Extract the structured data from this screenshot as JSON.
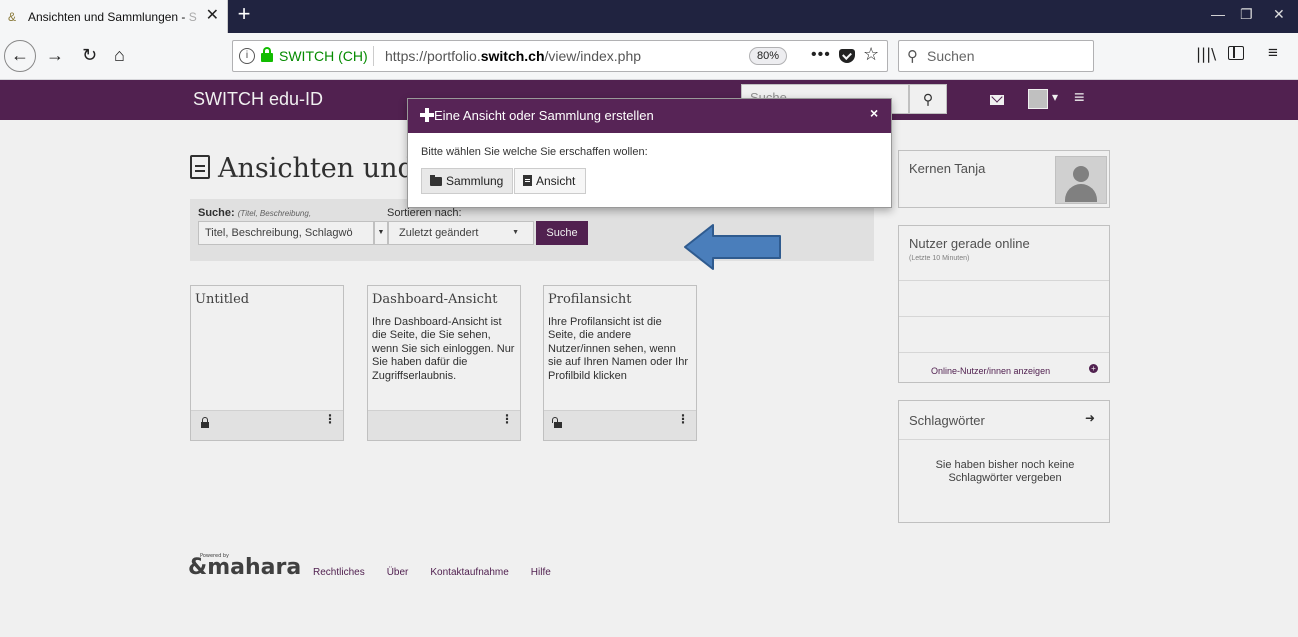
{
  "browser": {
    "tab": {
      "title": "Ansichten und Sammlungen - ",
      "title_fade": "S",
      "close": "✕"
    },
    "new_tab": "+",
    "window_controls": {
      "minimize": "—",
      "restore": "❐",
      "close": "✕"
    },
    "nav": {
      "back": "←",
      "forward": "→",
      "reload": "↻",
      "home": "⌂"
    },
    "url": {
      "info": "i",
      "identity": "SWITCH (CH)",
      "prefix": "https://portfolio.",
      "domain": "switch.ch",
      "path": "/view/index.php",
      "zoom": "80%",
      "more": "•••",
      "star": "☆"
    },
    "search": {
      "icon": "🔍",
      "placeholder": "Suchen"
    },
    "library": "|||\\",
    "menu": "≡"
  },
  "site": {
    "brand": "SWITCH edu-ID",
    "search_placeholder": "Suche",
    "search_icon": "🔍",
    "caret": "▾",
    "hamburger": "≡"
  },
  "page": {
    "title": "Ansichten und Sa",
    "filter": {
      "search_label": "Suche:",
      "search_hint": "(Titel, Beschreibung,",
      "sort_label": "Sortieren nach:",
      "search_select": "Titel, Beschreibung, Schlagwö",
      "select_caret": "▼",
      "sort_select": "Zuletzt geändert",
      "search_button": "Suche"
    },
    "cards": [
      {
        "title": "Untitled",
        "description": "",
        "lock": "locked"
      },
      {
        "title": "Dashboard-Ansicht",
        "description": "Ihre Dashboard-Ansicht ist die Seite, die Sie sehen, wenn Sie sich einloggen. Nur Sie haben dafür die Zugriffserlaubnis.",
        "lock": "none"
      },
      {
        "title": "Profilansicht",
        "description": "Ihre Profilansicht ist die Seite, die andere Nutzer/innen sehen, wenn sie auf Ihren Namen oder Ihr Profilbild klicken",
        "lock": "open"
      }
    ],
    "more_glyph": "⋮"
  },
  "footer": {
    "logo": "mahara",
    "powered": "Powered by",
    "links": [
      "Rechtliches",
      "Über",
      "Kontaktaufnahme",
      "Hilfe"
    ]
  },
  "sidebar": {
    "profile_name": "Kernen Tanja",
    "online_title": "Nutzer gerade online",
    "online_sub": "(Letzte 10 Minuten)",
    "online_link": "Online-Nutzer/innen anzeigen",
    "online_plus": "+",
    "tags_title": "Schlagwörter",
    "tags_arrow": "➜",
    "tags_empty": "Sie haben bisher noch keine Schlagwörter vergeben"
  },
  "modal": {
    "title": "Eine Ansicht oder Sammlung erstellen",
    "close": "×",
    "prompt": "Bitte wählen Sie welche Sie erschaffen wollen:",
    "button_sammlung": "Sammlung",
    "button_ansicht": "Ansicht"
  },
  "colors": {
    "brand_purple": "#572456",
    "annotation_arrow": "#4a7ebb",
    "secure_green": "#12bc00"
  }
}
